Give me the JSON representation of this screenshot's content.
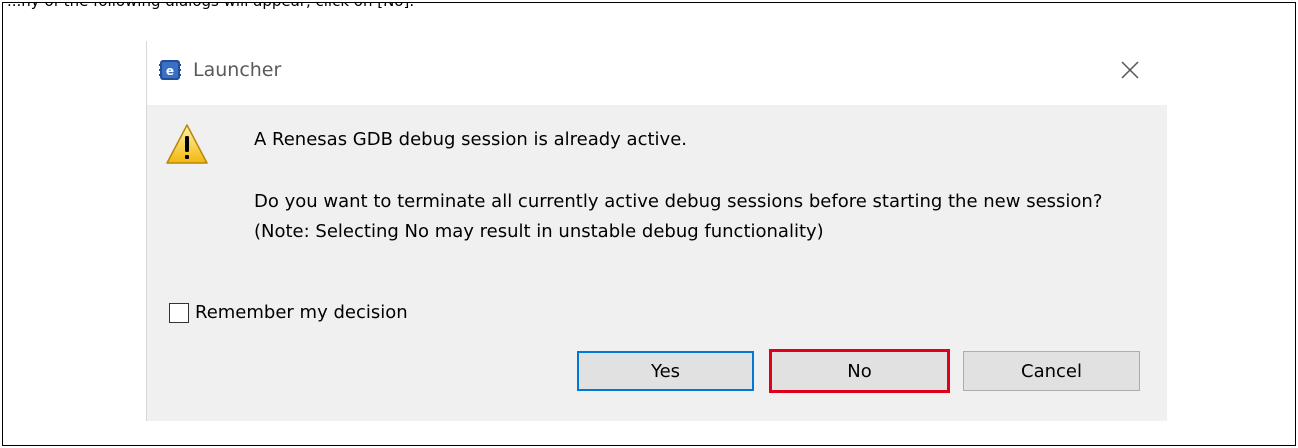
{
  "caption_fragment": "...ny of the following dialogs will appear, click on [No].",
  "dialog": {
    "title": "Launcher",
    "close_icon": "close-icon",
    "app_icon": "e2-studio-icon",
    "warning_icon": "warning-icon",
    "message_primary": "A Renesas GDB debug session is already active.",
    "message_secondary": "Do you want to terminate all currently active debug sessions before starting the new session? (Note: Selecting No may result in unstable debug functionality)",
    "remember_label": "Remember my decision",
    "remember_checked": false,
    "buttons": {
      "yes": "Yes",
      "no": "No",
      "cancel": "Cancel"
    }
  },
  "colors": {
    "highlight_border": "#e0001a",
    "default_button_border": "#0078d7",
    "warning_fill": "#f5c518"
  }
}
